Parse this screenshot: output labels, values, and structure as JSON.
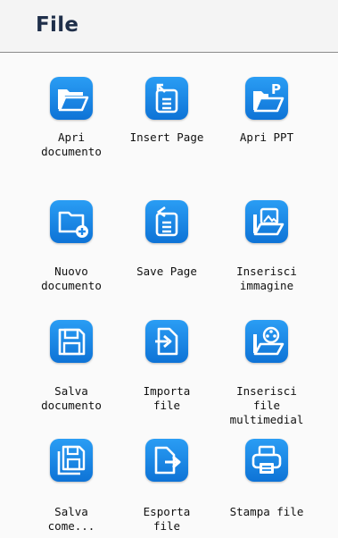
{
  "header": {
    "title": "File"
  },
  "items": [
    {
      "label": "Apri\ndocumento",
      "icon": "open-folder-icon"
    },
    {
      "label": "Insert Page",
      "icon": "insert-page-icon"
    },
    {
      "label": "Apri PPT",
      "icon": "open-ppt-icon"
    },
    {
      "label": "Nuovo\ndocumento",
      "icon": "new-document-icon"
    },
    {
      "label": "Save Page",
      "icon": "save-page-icon"
    },
    {
      "label": "Inserisci\nimmagine",
      "icon": "insert-image-icon"
    },
    {
      "label": "Salva\ndocumento",
      "icon": "save-icon"
    },
    {
      "label": "Importa\nfile",
      "icon": "import-file-icon"
    },
    {
      "label": "Inserisci\nfile\nmultimedial",
      "icon": "insert-multimedia-icon"
    },
    {
      "label": "Salva\ncome...",
      "icon": "save-as-icon"
    },
    {
      "label": "Esporta\nfile",
      "icon": "export-file-icon"
    },
    {
      "label": "Stampa file",
      "icon": "print-icon"
    }
  ],
  "colors": {
    "icon_bg": "#1a86e8",
    "title": "#1f2f4a"
  }
}
